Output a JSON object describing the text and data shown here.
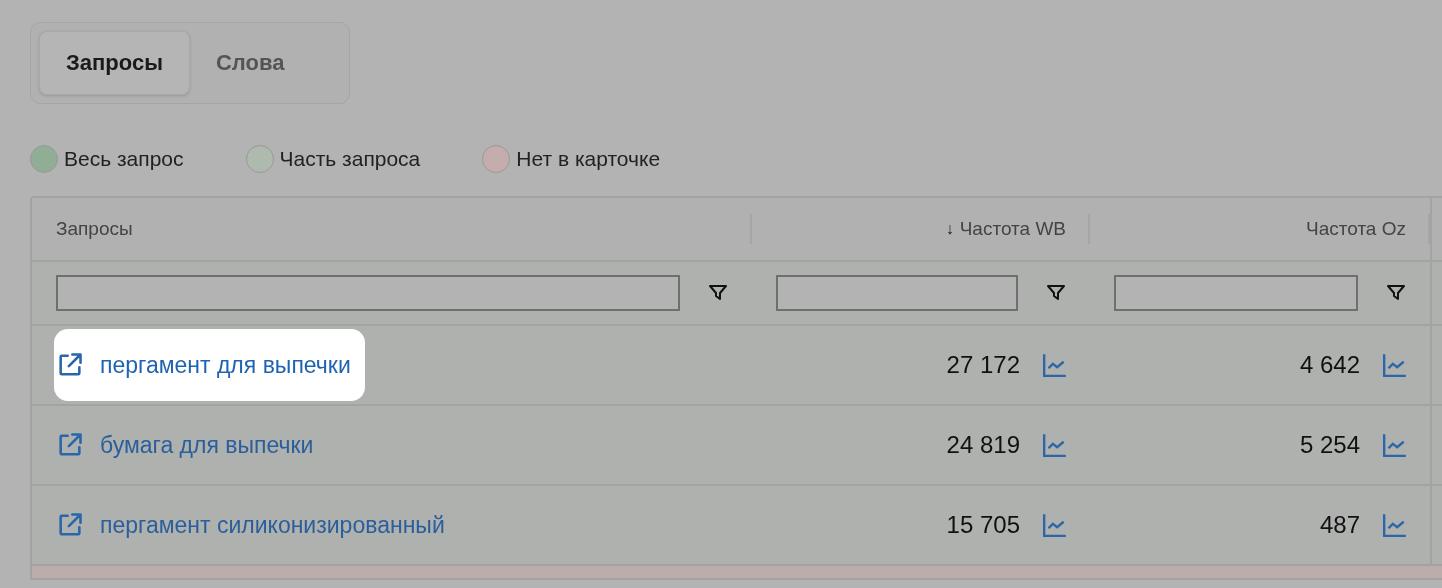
{
  "tabs": [
    {
      "label": "Запросы",
      "selected": true
    },
    {
      "label": "Слова",
      "selected": false
    }
  ],
  "legend": [
    {
      "label": "Весь запрос",
      "color": "#8fae95"
    },
    {
      "label": "Часть запроса",
      "color": "#adbaad"
    },
    {
      "label": "Нет в карточке",
      "color": "#c4adad"
    }
  ],
  "table": {
    "columns": [
      {
        "label": "Запросы"
      },
      {
        "label": "Частота WB",
        "sort_icon": "↓"
      },
      {
        "label": "Частота Oz"
      }
    ],
    "rows": [
      {
        "query": "пергамент для выпечки",
        "wb": "27 172",
        "oz": "4 642",
        "highlighted": true
      },
      {
        "query": "бумага для выпечки",
        "wb": "24 819",
        "oz": "5 254",
        "highlighted": false
      },
      {
        "query": "пергамент силиконизированный",
        "wb": "15 705",
        "oz": "487",
        "highlighted": false
      }
    ]
  }
}
